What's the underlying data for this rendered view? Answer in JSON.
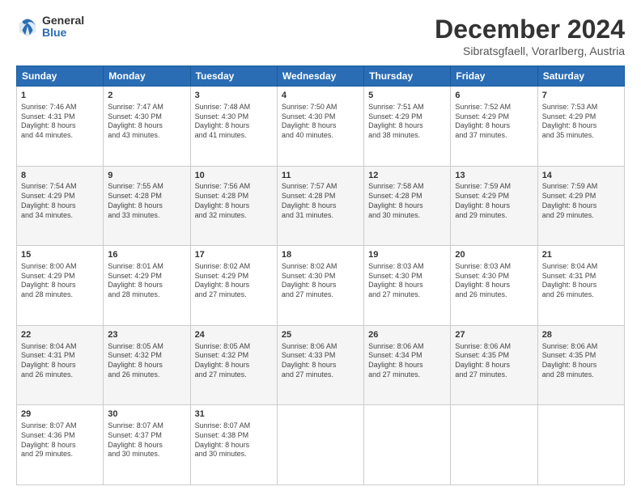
{
  "logo": {
    "general": "General",
    "blue": "Blue"
  },
  "header": {
    "title": "December 2024",
    "subtitle": "Sibratsgfaell, Vorarlberg, Austria"
  },
  "days_of_week": [
    "Sunday",
    "Monday",
    "Tuesday",
    "Wednesday",
    "Thursday",
    "Friday",
    "Saturday"
  ],
  "weeks": [
    [
      {
        "day": "1",
        "info": "Sunrise: 7:46 AM\nSunset: 4:31 PM\nDaylight: 8 hours\nand 44 minutes."
      },
      {
        "day": "2",
        "info": "Sunrise: 7:47 AM\nSunset: 4:30 PM\nDaylight: 8 hours\nand 43 minutes."
      },
      {
        "day": "3",
        "info": "Sunrise: 7:48 AM\nSunset: 4:30 PM\nDaylight: 8 hours\nand 41 minutes."
      },
      {
        "day": "4",
        "info": "Sunrise: 7:50 AM\nSunset: 4:30 PM\nDaylight: 8 hours\nand 40 minutes."
      },
      {
        "day": "5",
        "info": "Sunrise: 7:51 AM\nSunset: 4:29 PM\nDaylight: 8 hours\nand 38 minutes."
      },
      {
        "day": "6",
        "info": "Sunrise: 7:52 AM\nSunset: 4:29 PM\nDaylight: 8 hours\nand 37 minutes."
      },
      {
        "day": "7",
        "info": "Sunrise: 7:53 AM\nSunset: 4:29 PM\nDaylight: 8 hours\nand 35 minutes."
      }
    ],
    [
      {
        "day": "8",
        "info": "Sunrise: 7:54 AM\nSunset: 4:29 PM\nDaylight: 8 hours\nand 34 minutes."
      },
      {
        "day": "9",
        "info": "Sunrise: 7:55 AM\nSunset: 4:28 PM\nDaylight: 8 hours\nand 33 minutes."
      },
      {
        "day": "10",
        "info": "Sunrise: 7:56 AM\nSunset: 4:28 PM\nDaylight: 8 hours\nand 32 minutes."
      },
      {
        "day": "11",
        "info": "Sunrise: 7:57 AM\nSunset: 4:28 PM\nDaylight: 8 hours\nand 31 minutes."
      },
      {
        "day": "12",
        "info": "Sunrise: 7:58 AM\nSunset: 4:28 PM\nDaylight: 8 hours\nand 30 minutes."
      },
      {
        "day": "13",
        "info": "Sunrise: 7:59 AM\nSunset: 4:29 PM\nDaylight: 8 hours\nand 29 minutes."
      },
      {
        "day": "14",
        "info": "Sunrise: 7:59 AM\nSunset: 4:29 PM\nDaylight: 8 hours\nand 29 minutes."
      }
    ],
    [
      {
        "day": "15",
        "info": "Sunrise: 8:00 AM\nSunset: 4:29 PM\nDaylight: 8 hours\nand 28 minutes."
      },
      {
        "day": "16",
        "info": "Sunrise: 8:01 AM\nSunset: 4:29 PM\nDaylight: 8 hours\nand 28 minutes."
      },
      {
        "day": "17",
        "info": "Sunrise: 8:02 AM\nSunset: 4:29 PM\nDaylight: 8 hours\nand 27 minutes."
      },
      {
        "day": "18",
        "info": "Sunrise: 8:02 AM\nSunset: 4:30 PM\nDaylight: 8 hours\nand 27 minutes."
      },
      {
        "day": "19",
        "info": "Sunrise: 8:03 AM\nSunset: 4:30 PM\nDaylight: 8 hours\nand 27 minutes."
      },
      {
        "day": "20",
        "info": "Sunrise: 8:03 AM\nSunset: 4:30 PM\nDaylight: 8 hours\nand 26 minutes."
      },
      {
        "day": "21",
        "info": "Sunrise: 8:04 AM\nSunset: 4:31 PM\nDaylight: 8 hours\nand 26 minutes."
      }
    ],
    [
      {
        "day": "22",
        "info": "Sunrise: 8:04 AM\nSunset: 4:31 PM\nDaylight: 8 hours\nand 26 minutes."
      },
      {
        "day": "23",
        "info": "Sunrise: 8:05 AM\nSunset: 4:32 PM\nDaylight: 8 hours\nand 26 minutes."
      },
      {
        "day": "24",
        "info": "Sunrise: 8:05 AM\nSunset: 4:32 PM\nDaylight: 8 hours\nand 27 minutes."
      },
      {
        "day": "25",
        "info": "Sunrise: 8:06 AM\nSunset: 4:33 PM\nDaylight: 8 hours\nand 27 minutes."
      },
      {
        "day": "26",
        "info": "Sunrise: 8:06 AM\nSunset: 4:34 PM\nDaylight: 8 hours\nand 27 minutes."
      },
      {
        "day": "27",
        "info": "Sunrise: 8:06 AM\nSunset: 4:35 PM\nDaylight: 8 hours\nand 27 minutes."
      },
      {
        "day": "28",
        "info": "Sunrise: 8:06 AM\nSunset: 4:35 PM\nDaylight: 8 hours\nand 28 minutes."
      }
    ],
    [
      {
        "day": "29",
        "info": "Sunrise: 8:07 AM\nSunset: 4:36 PM\nDaylight: 8 hours\nand 29 minutes."
      },
      {
        "day": "30",
        "info": "Sunrise: 8:07 AM\nSunset: 4:37 PM\nDaylight: 8 hours\nand 30 minutes."
      },
      {
        "day": "31",
        "info": "Sunrise: 8:07 AM\nSunset: 4:38 PM\nDaylight: 8 hours\nand 30 minutes."
      },
      null,
      null,
      null,
      null
    ]
  ]
}
